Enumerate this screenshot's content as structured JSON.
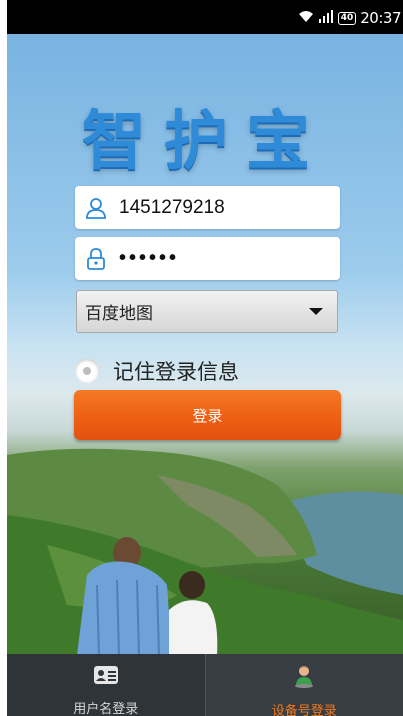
{
  "status_bar": {
    "battery": "40",
    "time": "20:37"
  },
  "app": {
    "logo_text": "智护宝"
  },
  "login_form": {
    "username": "1451279218",
    "password_masked": "••••••",
    "map_select": "百度地图",
    "remember_label": "记住登录信息",
    "remember_checked": false,
    "login_button": "登录"
  },
  "tabs": [
    {
      "label": "用户名登录",
      "icon": "id-card-icon",
      "active": false
    },
    {
      "label": "设备号登录",
      "icon": "person-icon",
      "active": true
    }
  ],
  "colors": {
    "accent": "#ee5f14",
    "logo_blue": "#2f8ad8",
    "tab_active": "#f07a1b"
  }
}
